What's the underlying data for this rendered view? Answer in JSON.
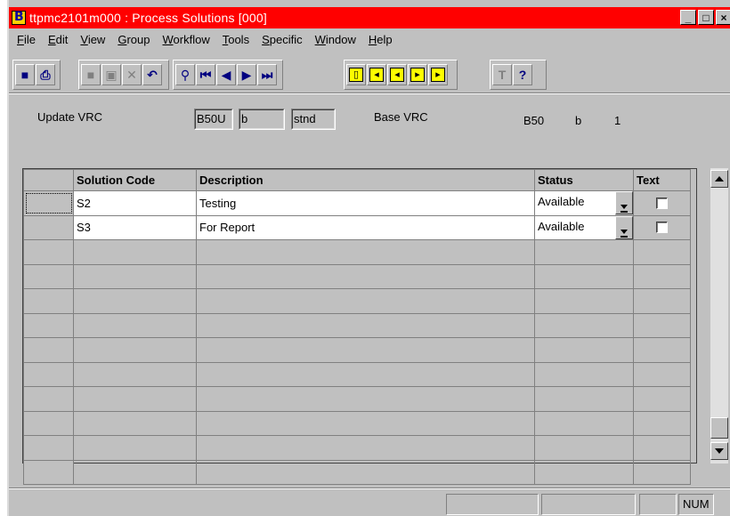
{
  "window": {
    "title": "ttpmc2101m000 : Process Solutions [000]",
    "buttons": {
      "minimize": "_",
      "maximize": "□",
      "close": "×"
    }
  },
  "menu": [
    {
      "label": "File",
      "ul": "F",
      "rest": "ile"
    },
    {
      "label": "Edit",
      "ul": "E",
      "rest": "dit"
    },
    {
      "label": "View",
      "ul": "V",
      "rest": "iew"
    },
    {
      "label": "Group",
      "ul": "G",
      "rest": "roup"
    },
    {
      "label": "Workflow",
      "ul": "W",
      "rest": "orkflow"
    },
    {
      "label": "Tools",
      "ul": "T",
      "rest": "ools"
    },
    {
      "label": "Specific",
      "ul": "S",
      "rest": "pecific"
    },
    {
      "label": "Window",
      "ul": "W",
      "rest": "indow"
    },
    {
      "label": "Help",
      "ul": "H",
      "rest": "elp"
    }
  ],
  "toolbar": {
    "icons": [
      "save-icon",
      "print-icon",
      "new-icon",
      "duplicate-icon",
      "delete-icon",
      "undo-icon",
      "find-icon",
      "first-record-icon",
      "previous-record-icon",
      "next-record-icon",
      "last-record-icon",
      "group-first-icon",
      "group-previous-icon",
      "group-next-icon",
      "group-last-icon",
      "group-extra-icon",
      "text-icon",
      "help-pointer-icon"
    ],
    "glyphs": {
      "save": "■",
      "print": "⎙",
      "new": "■",
      "duplicate": "▣",
      "delete": "✕",
      "undo": "↶",
      "find": "⚲",
      "first": "⏮",
      "prev": "◀",
      "next": "▶",
      "last": "⏭",
      "g1": "▯",
      "g2": "◂",
      "g3": "◂",
      "g4": "▸",
      "g5": "▸",
      "text": "T",
      "help": "?"
    }
  },
  "header": {
    "update_vrc_label": "Update VRC",
    "update_vrc_version": "B50U",
    "update_vrc_release": "b",
    "update_vrc_customer": "stnd",
    "base_vrc_label": "Base VRC",
    "base_vrc_version": "B50",
    "base_vrc_release": "b",
    "base_vrc_customer": "1"
  },
  "table": {
    "columns": [
      "Solution Code",
      "Description",
      "Status",
      "Text"
    ],
    "rows": [
      {
        "code": "S2",
        "description": "Testing",
        "status": "Available",
        "text": false
      },
      {
        "code": "S3",
        "description": "For Report",
        "status": "Available",
        "text": false
      }
    ],
    "empty_rows": 10
  },
  "statusbar": {
    "num": "NUM"
  }
}
